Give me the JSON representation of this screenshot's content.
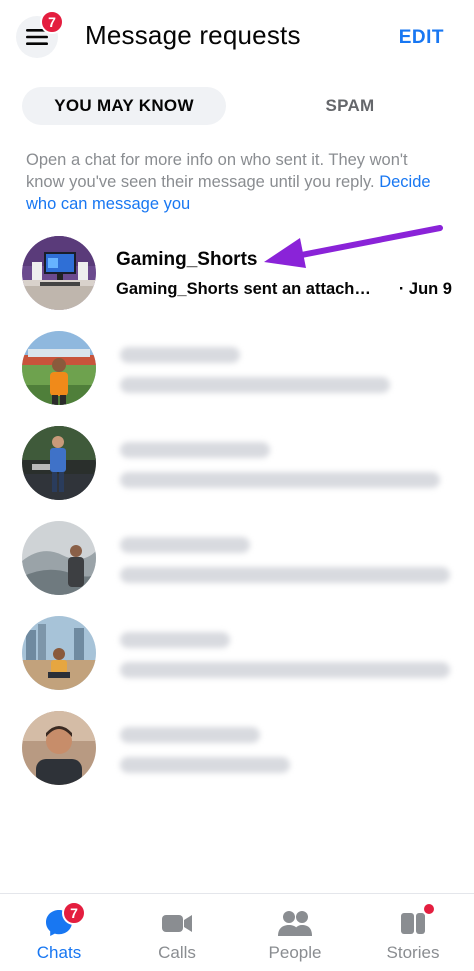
{
  "header": {
    "menu_badge": "7",
    "title": "Message requests",
    "edit_label": "EDIT"
  },
  "tabs": [
    {
      "label": "YOU MAY KNOW",
      "active": true
    },
    {
      "label": "SPAM",
      "active": false
    }
  ],
  "info": {
    "text": "Open a chat for more info on who sent it. They won't know you've seen their message until you reply. ",
    "link_text": "Decide who can message you"
  },
  "requests": [
    {
      "name": "Gaming_Shorts",
      "preview": "Gaming_Shorts sent an attach…",
      "date": "· Jun 9",
      "blurred": false,
      "avatar_icon": "gaming-setup-photo"
    },
    {
      "name": "",
      "preview": "",
      "date": "",
      "blurred": true,
      "avatar_icon": "person-outdoor-photo"
    },
    {
      "name": "",
      "preview": "",
      "date": "",
      "blurred": true,
      "avatar_icon": "person-standing-photo"
    },
    {
      "name": "",
      "preview": "",
      "date": "",
      "blurred": true,
      "avatar_icon": "person-misty-hills-photo"
    },
    {
      "name": "",
      "preview": "",
      "date": "",
      "blurred": true,
      "avatar_icon": "person-sitting-city-photo"
    },
    {
      "name": "",
      "preview": "",
      "date": "",
      "blurred": true,
      "avatar_icon": "person-portrait-photo"
    }
  ],
  "bottom_nav": [
    {
      "label": "Chats",
      "icon": "chat-bubble-icon",
      "active": true,
      "badge": "7"
    },
    {
      "label": "Calls",
      "icon": "video-camera-icon",
      "active": false
    },
    {
      "label": "People",
      "icon": "people-icon",
      "active": false
    },
    {
      "label": "Stories",
      "icon": "stories-icon",
      "active": false,
      "dot": true
    }
  ],
  "colors": {
    "accent": "#1877f2",
    "badge": "#e41e3f",
    "annotation_arrow": "#8a23d8"
  }
}
